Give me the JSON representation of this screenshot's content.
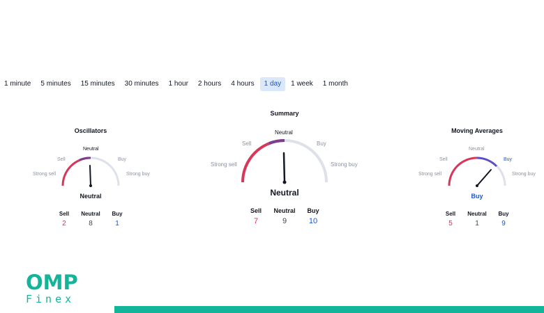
{
  "timeframes": {
    "items": [
      "1 minute",
      "5 minutes",
      "15 minutes",
      "30 minutes",
      "1 hour",
      "2 hours",
      "4 hours",
      "1 day",
      "1 week",
      "1 month"
    ],
    "selected": "1 day"
  },
  "oscillators": {
    "title": "Oscillators",
    "labels": {
      "strong_sell": "Strong sell",
      "sell": "Sell",
      "neutral": "Neutral",
      "buy": "Buy",
      "strong_buy": "Strong buy"
    },
    "result": "Neutral",
    "counts": {
      "sell_label": "Sell",
      "sell": "2",
      "neutral_label": "Neutral",
      "neutral": "8",
      "buy_label": "Buy",
      "buy": "1"
    }
  },
  "summary": {
    "title": "Summary",
    "labels": {
      "strong_sell": "Strong sell",
      "sell": "Sell",
      "neutral": "Neutral",
      "buy": "Buy",
      "strong_buy": "Strong buy"
    },
    "result": "Neutral",
    "counts": {
      "sell_label": "Sell",
      "sell": "7",
      "neutral_label": "Neutral",
      "neutral": "9",
      "buy_label": "Buy",
      "buy": "10"
    }
  },
  "moving_averages": {
    "title": "Moving Averages",
    "labels": {
      "strong_sell": "Strong sell",
      "sell": "Sell",
      "neutral": "Neutral",
      "buy": "Buy",
      "strong_buy": "Strong buy"
    },
    "result": "Buy",
    "counts": {
      "sell_label": "Sell",
      "sell": "5",
      "neutral_label": "Neutral",
      "neutral": "1",
      "buy_label": "Buy",
      "buy": "9"
    }
  },
  "brand": {
    "line1": "OMP",
    "line2": "Finex"
  },
  "colors": {
    "accent": "#13b59a",
    "sell": "#e0304b",
    "buy": "#1d56c8",
    "neutral_arc": "#7b3f8f",
    "track": "#dfe1ea",
    "selected_tab_bg": "#dbe7fb"
  }
}
